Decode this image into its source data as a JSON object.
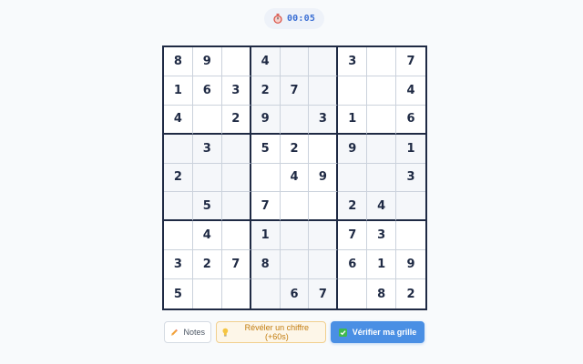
{
  "timer": {
    "icon": "stopwatch-icon",
    "value": "00:05"
  },
  "grid": [
    [
      "8",
      "9",
      "",
      "4",
      "",
      "",
      "3",
      "",
      "7"
    ],
    [
      "1",
      "6",
      "3",
      "2",
      "7",
      "",
      "",
      "",
      "4"
    ],
    [
      "4",
      "",
      "2",
      "9",
      "",
      "3",
      "1",
      "",
      "6"
    ],
    [
      "",
      "3",
      "",
      "5",
      "2",
      "",
      "9",
      "",
      "1"
    ],
    [
      "2",
      "",
      "",
      "",
      "4",
      "9",
      "",
      "",
      "3"
    ],
    [
      "",
      "5",
      "",
      "7",
      "",
      "",
      "2",
      "4",
      ""
    ],
    [
      "",
      "4",
      "",
      "1",
      "",
      "",
      "7",
      "3",
      ""
    ],
    [
      "3",
      "2",
      "7",
      "8",
      "",
      "",
      "6",
      "1",
      "9"
    ],
    [
      "5",
      "",
      "",
      "",
      "6",
      "7",
      "",
      "8",
      "2"
    ]
  ],
  "actions": {
    "notes": {
      "label": "Notes",
      "icon": "pencil-icon"
    },
    "reveal": {
      "label": "Révéler un chiffre (+60s)",
      "icon": "lightbulb-icon"
    },
    "verify": {
      "label": "Vérifier ma grille",
      "icon": "check-box-icon"
    }
  },
  "colors": {
    "accent": "#4a8fe4",
    "timer_text": "#3b6fd4",
    "reveal_text": "#c27c0e",
    "board_border": "#1f2a44"
  }
}
